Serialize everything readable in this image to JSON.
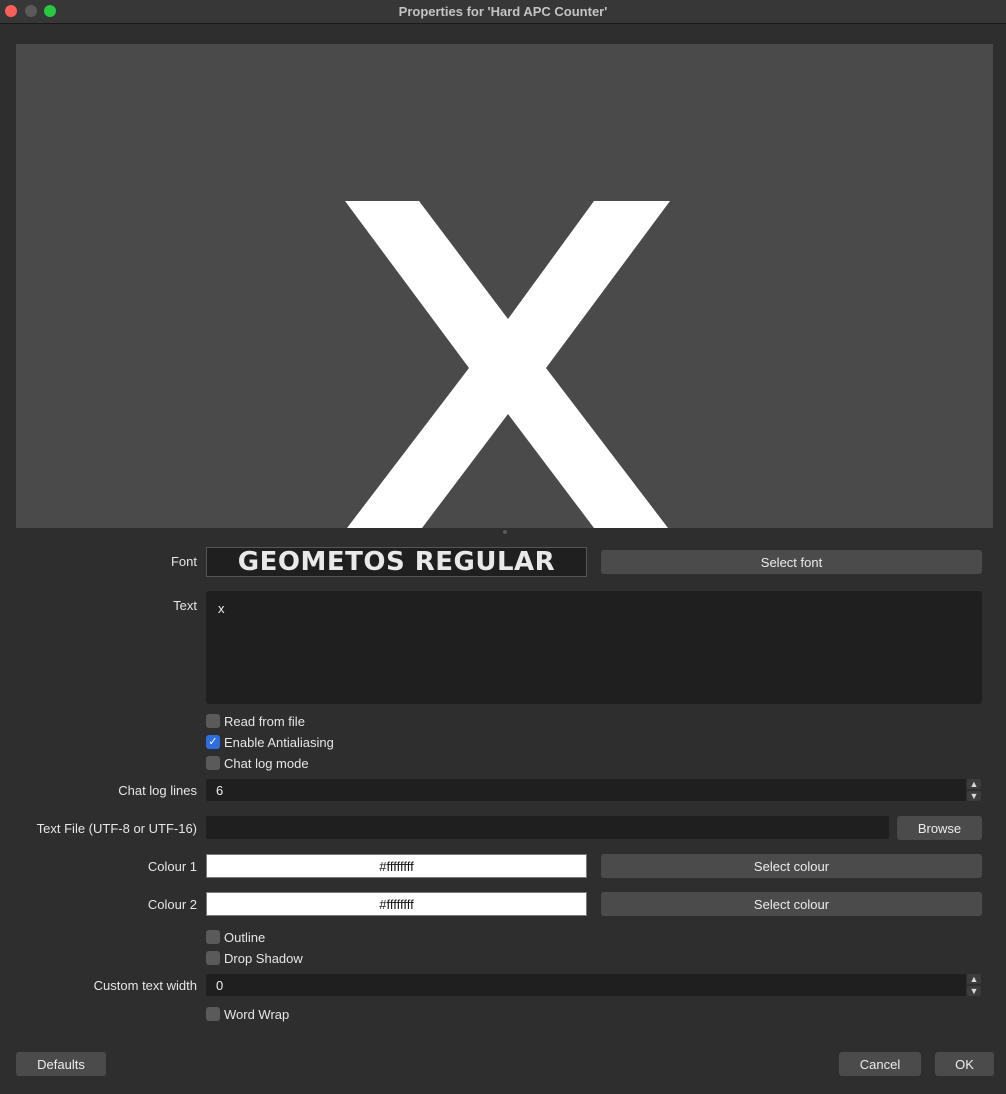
{
  "window": {
    "title": "Properties for 'Hard APC Counter'",
    "traffic_colors": {
      "close": "#fe5f57",
      "minimize": "#5a5a5a",
      "maximize": "#28c840"
    }
  },
  "preview": {
    "glyph": "X",
    "background": "#4a4a4a",
    "glyph_color": "#ffffff"
  },
  "form": {
    "font": {
      "label": "Font",
      "value": "GEOMETOS REGULAR",
      "button": "Select font"
    },
    "text": {
      "label": "Text",
      "value": "x"
    },
    "checkboxes_top": [
      {
        "label": "Read from file",
        "checked": false
      },
      {
        "label": "Enable Antialiasing",
        "checked": true
      },
      {
        "label": "Chat log mode",
        "checked": false
      }
    ],
    "chat_log_lines": {
      "label": "Chat log lines",
      "value": "6"
    },
    "text_file": {
      "label": "Text File (UTF-8 or UTF-16)",
      "value": "",
      "button": "Browse"
    },
    "colour1": {
      "label": "Colour 1",
      "value": "#ffffffff",
      "button": "Select colour"
    },
    "colour2": {
      "label": "Colour 2",
      "value": "#ffffffff",
      "button": "Select colour"
    },
    "checkboxes_mid": [
      {
        "label": "Outline",
        "checked": false
      },
      {
        "label": "Drop Shadow",
        "checked": false
      }
    ],
    "custom_text_width": {
      "label": "Custom text width",
      "value": "0"
    },
    "checkboxes_bottom": [
      {
        "label": "Word Wrap",
        "checked": false
      }
    ]
  },
  "footer": {
    "defaults": "Defaults",
    "cancel": "Cancel",
    "ok": "OK"
  },
  "icons": {
    "check": "checkmark-icon",
    "spin_up": "chevron-up-icon",
    "spin_down": "chevron-down-icon"
  }
}
